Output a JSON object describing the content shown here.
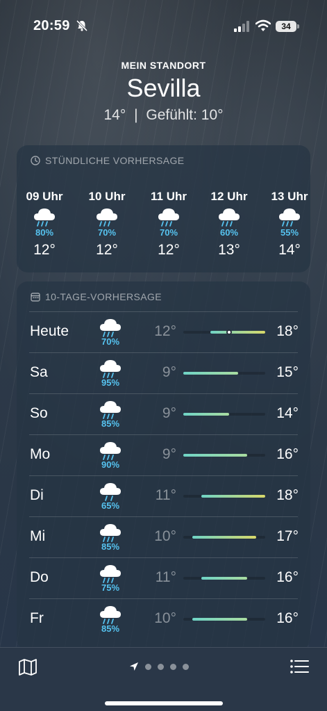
{
  "status_bar": {
    "time": "20:59",
    "battery": "34",
    "icons": [
      "bell-slash-icon",
      "signal-icon",
      "wifi-icon",
      "battery-icon"
    ]
  },
  "header": {
    "location_label": "MEIN STANDORT",
    "city": "Sevilla",
    "current_temp": "14°",
    "separator": "|",
    "feels_like": "Gefühlt: 10°"
  },
  "hourly": {
    "title": "STÜNDLICHE VORHERSAGE",
    "icon": "clock-icon",
    "items": [
      {
        "time": "09 Uhr",
        "precip": "80%",
        "temp": "12°",
        "icon": "cloud-rain-icon"
      },
      {
        "time": "10 Uhr",
        "precip": "70%",
        "temp": "12°",
        "icon": "cloud-rain-icon"
      },
      {
        "time": "11 Uhr",
        "precip": "70%",
        "temp": "12°",
        "icon": "cloud-rain-icon"
      },
      {
        "time": "12 Uhr",
        "precip": "60%",
        "temp": "13°",
        "icon": "cloud-rain-icon"
      },
      {
        "time": "13 Uhr",
        "precip": "55%",
        "temp": "14°",
        "icon": "cloud-rain-icon"
      }
    ]
  },
  "daily": {
    "title": "10-TAGE-VORHERSAGE",
    "icon": "calendar-icon",
    "scale": {
      "min": 9,
      "max": 18,
      "current": 14
    },
    "items": [
      {
        "day": "Heute",
        "precip": "70%",
        "low": "12°",
        "high": "18°",
        "lo": 12,
        "hi": 18,
        "icon": "cloud-heavy-rain-icon"
      },
      {
        "day": "Sa",
        "precip": "95%",
        "low": "9°",
        "high": "15°",
        "lo": 9,
        "hi": 15,
        "icon": "cloud-rain-icon"
      },
      {
        "day": "So",
        "precip": "85%",
        "low": "9°",
        "high": "14°",
        "lo": 9,
        "hi": 14,
        "icon": "cloud-rain-icon"
      },
      {
        "day": "Mo",
        "precip": "90%",
        "low": "9°",
        "high": "16°",
        "lo": 9,
        "hi": 16,
        "icon": "cloud-rain-icon"
      },
      {
        "day": "Di",
        "precip": "65%",
        "low": "11°",
        "high": "18°",
        "lo": 11,
        "hi": 18,
        "icon": "cloud-drizzle-icon"
      },
      {
        "day": "Mi",
        "precip": "85%",
        "low": "10°",
        "high": "17°",
        "lo": 10,
        "hi": 17,
        "icon": "cloud-rain-icon"
      },
      {
        "day": "Do",
        "precip": "75%",
        "low": "11°",
        "high": "16°",
        "lo": 11,
        "hi": 16,
        "icon": "cloud-rain-icon"
      },
      {
        "day": "Fr",
        "precip": "85%",
        "low": "10°",
        "high": "16°",
        "lo": 10,
        "hi": 16,
        "icon": "cloud-rain-icon"
      }
    ]
  },
  "toolbar": {
    "pages": 4,
    "icons": [
      "map-icon",
      "location-arrow-icon",
      "list-icon"
    ]
  },
  "colors": {
    "precip": "#56c3f0",
    "bar_cool": "#6fd4c6",
    "bar_warm": "#d8d96a"
  }
}
